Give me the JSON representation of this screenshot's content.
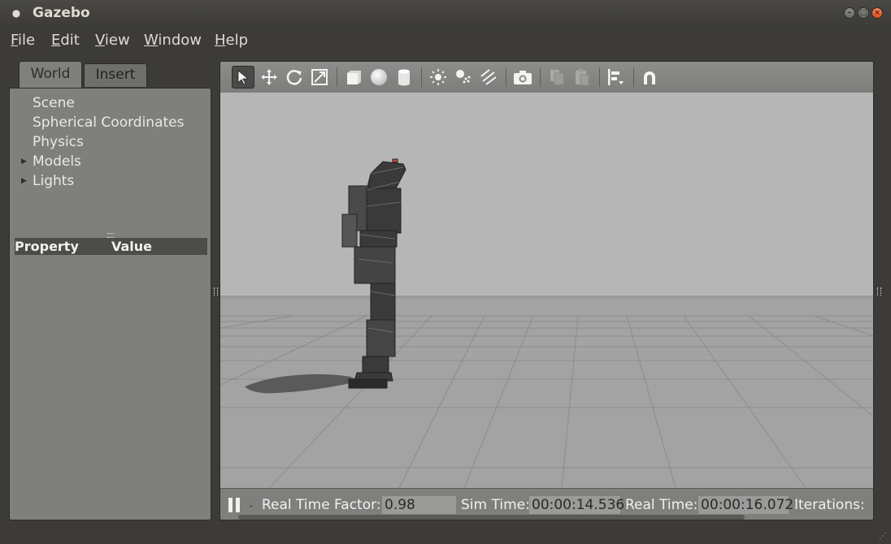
{
  "window": {
    "title": "Gazebo",
    "buttons": {
      "minimize": "–",
      "maximize": "□",
      "close": "×"
    }
  },
  "menubar": {
    "items": [
      {
        "accel": "F",
        "rest": "ile"
      },
      {
        "accel": "E",
        "rest": "dit"
      },
      {
        "accel": "V",
        "rest": "iew"
      },
      {
        "accel": "W",
        "rest": "indow"
      },
      {
        "accel": "H",
        "rest": "elp"
      }
    ]
  },
  "left_panel": {
    "tabs": [
      "World",
      "Insert"
    ],
    "active_tab": "World",
    "tree": [
      {
        "label": "Scene",
        "expandable": false
      },
      {
        "label": "Spherical Coordinates",
        "expandable": false
      },
      {
        "label": "Physics",
        "expandable": false
      },
      {
        "label": "Models",
        "expandable": true
      },
      {
        "label": "Lights",
        "expandable": true
      }
    ],
    "property_table": {
      "col1": "Property",
      "col2": "Value"
    }
  },
  "toolbar": {
    "icons": [
      "select-arrow-icon",
      "translate-icon",
      "rotate-icon",
      "scale-icon",
      "box-icon",
      "sphere-icon",
      "cylinder-icon",
      "point-light-icon",
      "spot-light-icon",
      "directional-light-icon",
      "screenshot-icon",
      "copy-icon",
      "paste-icon",
      "align-icon",
      "snap-icon"
    ],
    "active": "select-arrow-icon"
  },
  "statusbar": {
    "step_label": "-",
    "real_time_factor_label": "Real Time Factor:",
    "real_time_factor": "0.98",
    "sim_time_label": "Sim Time:",
    "sim_time": "00:00:14.536",
    "real_time_label": "Real Time:",
    "real_time": "00:00:16.072",
    "iterations_label": "Iterations:"
  },
  "colors": {
    "titlebar": "#3c3b37",
    "panel": "#7f7f7e",
    "sky": "#b6b6b6",
    "ground": "#a4a4a4",
    "grid": "#8a8a8a",
    "close_button": "#df4b16"
  }
}
